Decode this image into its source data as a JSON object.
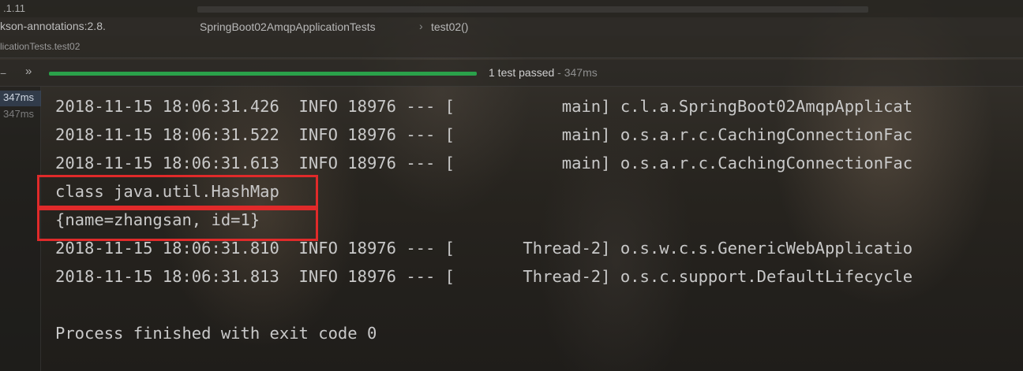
{
  "top": {
    "version": ".1.11"
  },
  "nav": {
    "library": "kson-annotations:2.8.",
    "breadcrumb": [
      "SpringBoot02AmqpApplicationTests",
      "test02()"
    ],
    "separator": "›"
  },
  "tab": {
    "label": "licationTests.test02"
  },
  "toolbar": {
    "dash": "−",
    "expand": "»",
    "progress": 1.0,
    "status_text": "1 test passed",
    "status_duration": " - 347ms"
  },
  "tree": {
    "selected_time": "347ms",
    "second_time": "347ms"
  },
  "console": {
    "lines": [
      "2018-11-15 18:06:31.426  INFO 18976 --- [           main] c.l.a.SpringBoot02AmqpApplicat",
      "2018-11-15 18:06:31.522  INFO 18976 --- [           main] o.s.a.r.c.CachingConnectionFac",
      "2018-11-15 18:06:31.613  INFO 18976 --- [           main] o.s.a.r.c.CachingConnectionFac",
      "class java.util.HashMap",
      "{name=zhangsan, id=1}",
      "2018-11-15 18:06:31.810  INFO 18976 --- [       Thread-2] o.s.w.c.s.GenericWebApplicatio",
      "2018-11-15 18:06:31.813  INFO 18976 --- [       Thread-2] o.s.c.support.DefaultLifecycle",
      "",
      "Process finished with exit code 0"
    ]
  },
  "colors": {
    "highlight_border": "#e02a2a",
    "progress_fill": "#2aa14a"
  }
}
